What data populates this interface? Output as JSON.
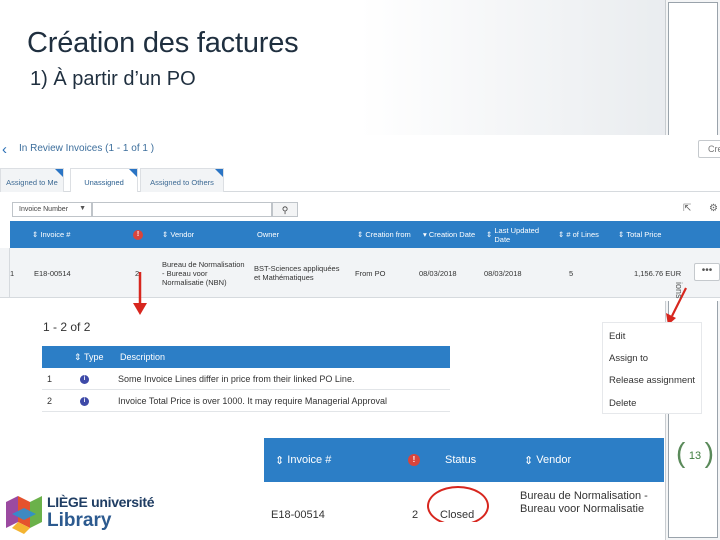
{
  "slide": {
    "title": "Création des factures",
    "subtitle": "1) À partir d’un PO",
    "page_number": "13"
  },
  "header": {
    "title": "In Review Invoices (1 - 1 of 1 )",
    "right_button": "Cre"
  },
  "tabs": [
    {
      "label": "Assigned to Me"
    },
    {
      "label": "Unassigned"
    },
    {
      "label": "Assigned to Others"
    }
  ],
  "filter": {
    "field": "Invoice Number"
  },
  "table": {
    "headers": {
      "invoice": "Invoice #",
      "alert": "!",
      "vendor": "Vendor",
      "owner": "Owner",
      "creation_from": "Creation from",
      "creation_date": "Creation Date",
      "last_updated": "Last Updated Date",
      "lines": "# of Lines",
      "total_price": "Total Price"
    },
    "row": {
      "index": "1",
      "invoice": "E18-00514",
      "alert": "2",
      "vendor": "Bureau de Normalisation - Bureau voor Normalisatie (NBN)",
      "owner": "BST-Sciences appliquées et Mathématiques",
      "creation_from": "From PO",
      "creation_date": "08/03/2018",
      "last_updated": "08/03/2018",
      "lines": "5",
      "total_price": "1,156.76 EUR",
      "more": "•••"
    }
  },
  "issues": {
    "count": "1 - 2 of 2",
    "headers": {
      "type": "Type",
      "description": "Description"
    },
    "rows": [
      {
        "index": "1",
        "description": "Some Invoice Lines differ in price from their linked PO Line."
      },
      {
        "index": "2",
        "description": "Invoice Total Price is over 1000. It may require Managerial Approval"
      }
    ]
  },
  "context_menu": {
    "items": [
      "Edit",
      "Assign to",
      "Release assignment",
      "Delete"
    ]
  },
  "cut_text": "ions",
  "detail_table": {
    "headers": {
      "invoice": "Invoice #",
      "status": "Status",
      "vendor": "Vendor"
    },
    "row": {
      "invoice": "E18-00514",
      "alert": "2",
      "status": "Closed",
      "vendor": "Bureau de Normalisation - Bureau voor Normalisatie"
    }
  },
  "logo": {
    "university": "LIÈGE université",
    "library": "Library"
  },
  "colors": {
    "table_header": "#2c7ec6",
    "highlight_red": "#d7261e",
    "alert_red": "#d9453b",
    "info_indigo": "#3e4aa8"
  }
}
